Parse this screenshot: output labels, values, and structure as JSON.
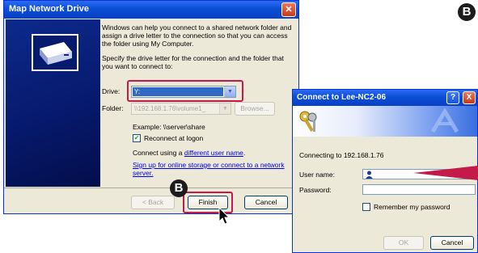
{
  "map_drive": {
    "title": "Map Network Drive",
    "intro": "Windows can help you connect to a shared network folder and assign a drive letter to the connection so that you can access the folder using My Computer.",
    "specify": "Specify the drive letter for the connection and the folder that you want to connect to:",
    "drive_label": "Drive:",
    "drive_value": "Y:",
    "folder_label": "Folder:",
    "folder_value": "\\\\192.168.1.76\\volume1_",
    "browse_label": "Browse...",
    "example": "Example: \\\\server\\share",
    "reconnect_label": "Reconnect at logon",
    "reconnect_checked": true,
    "connect_using_prefix": "Connect using a ",
    "connect_using_link": "different user name",
    "connect_using_suffix": ".",
    "signup_link": "Sign up for online storage or connect to a network server.",
    "back_label": "< Back",
    "finish_label": "Finish",
    "cancel_label": "Cancel"
  },
  "connect_dialog": {
    "title": "Connect to Lee-NC2-06",
    "connecting_text": "Connecting to 192.168.1.76",
    "username_label": "User name:",
    "password_label": "Password:",
    "remember_label": "Remember my password",
    "ok_label": "OK",
    "cancel_label": "Cancel",
    "help_glyph": "?",
    "close_glyph": "X"
  },
  "badges": {
    "b1": "B",
    "b2": "B"
  },
  "colors": {
    "highlight": "#c41a4a",
    "titlebar": "#0a4ed6",
    "selection": "#316ac5"
  },
  "icons": [
    "network-drive-icon",
    "keys-icon",
    "close-icon",
    "help-icon",
    "chevron-down-icon",
    "mouse-cursor-icon",
    "pointer-arrow-icon"
  ]
}
